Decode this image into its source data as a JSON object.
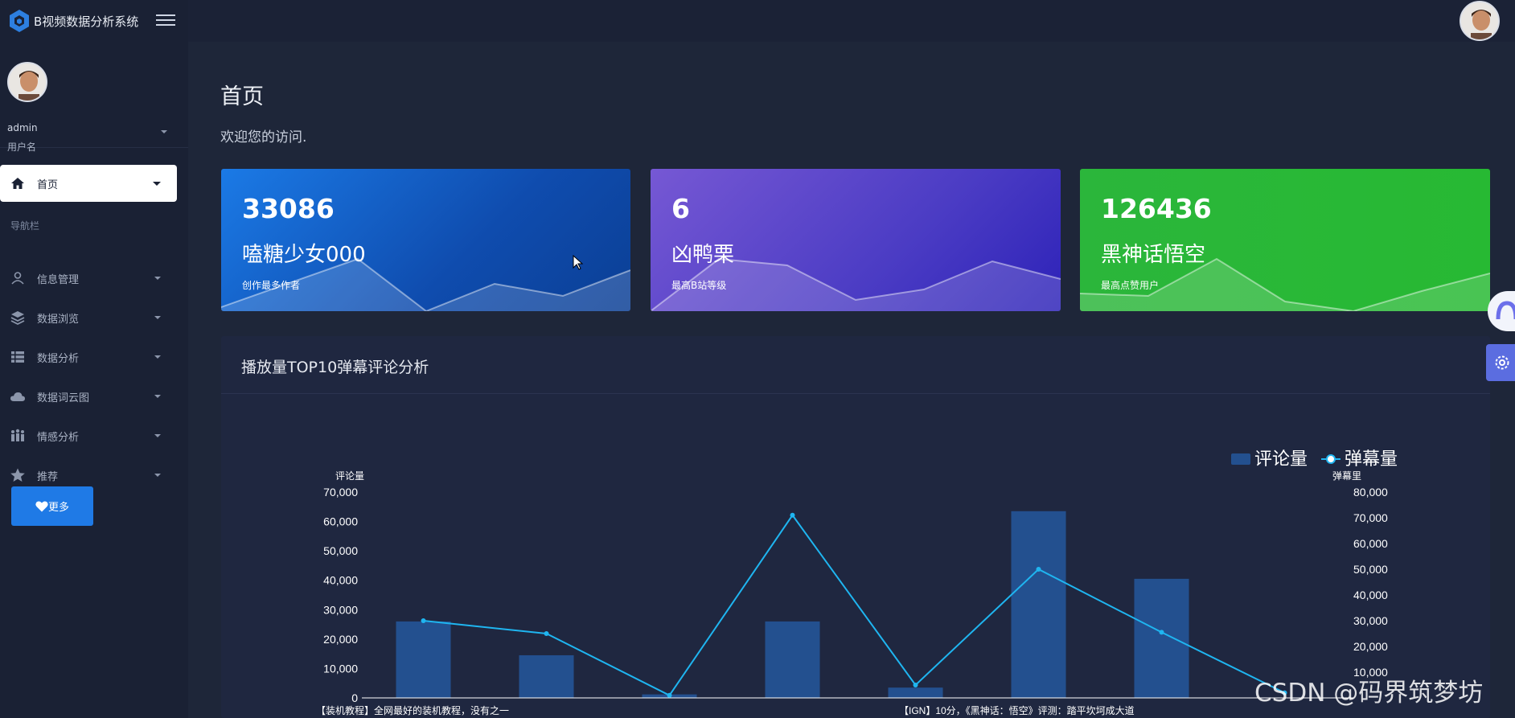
{
  "app": {
    "title": "B视频数据分析系统"
  },
  "user": {
    "name": "admin",
    "role": "用户名"
  },
  "sidebar": {
    "home_label": "首页",
    "nav_header": "导航栏",
    "items": [
      {
        "label": "信息管理",
        "icon": "user-icon"
      },
      {
        "label": "数据浏览",
        "icon": "layers-icon"
      },
      {
        "label": "数据分析",
        "icon": "table-icon"
      },
      {
        "label": "数据词云图",
        "icon": "cloud-icon"
      },
      {
        "label": "情感分析",
        "icon": "people-icon"
      },
      {
        "label": "推荐",
        "icon": "star-icon"
      }
    ],
    "more_label": "更多"
  },
  "page": {
    "title": "首页",
    "subtitle": "欢迎您的访问."
  },
  "cards": [
    {
      "number": "33086",
      "name": "嗑糖少女000",
      "desc": "创作最多作者",
      "color": "#1b7ae6"
    },
    {
      "number": "6",
      "name": "凶鸭栗",
      "desc": "最高B站等级",
      "color": "#6a4fd0"
    },
    {
      "number": "126436",
      "name": "黑神话悟空",
      "desc": "最高点赞用户",
      "color": "#2bb63b"
    }
  ],
  "panel": {
    "title": "播放量TOP10弹幕评论分析"
  },
  "chart_data": {
    "type": "bar",
    "title": "",
    "legend": [
      "评论量",
      "弹幕量"
    ],
    "legend_position": "top-right",
    "y_left_label": "评论量",
    "y_right_label": "弹幕里",
    "y_left_ticks": [
      "0",
      "10,000",
      "20,000",
      "30,000",
      "40,000",
      "50,000",
      "60,000",
      "70,000"
    ],
    "y_right_ticks": [
      "10,000",
      "20,000",
      "30,000",
      "40,000",
      "50,000",
      "60,000",
      "70,000",
      "80,000"
    ],
    "ylim_left": [
      0,
      70000
    ],
    "ylim_right": [
      0,
      80000
    ],
    "x_labels_visible": [
      "【装机教程】全网最好的装机教程，没有之一",
      "【IGN】10分，《黑神话：悟空》评测：踏平坎坷成大道"
    ],
    "series": [
      {
        "name": "评论量",
        "values": [
          26000,
          14500,
          1200,
          26000,
          3500,
          63500,
          40500
        ],
        "color": "#23508f"
      },
      {
        "name": "弹幕量",
        "values": [
          30000,
          25000,
          1000,
          71000,
          5000,
          50000,
          25500,
          2000
        ],
        "color": "#1fb5f0"
      }
    ]
  },
  "watermark": "CSDN @码界筑梦坊"
}
